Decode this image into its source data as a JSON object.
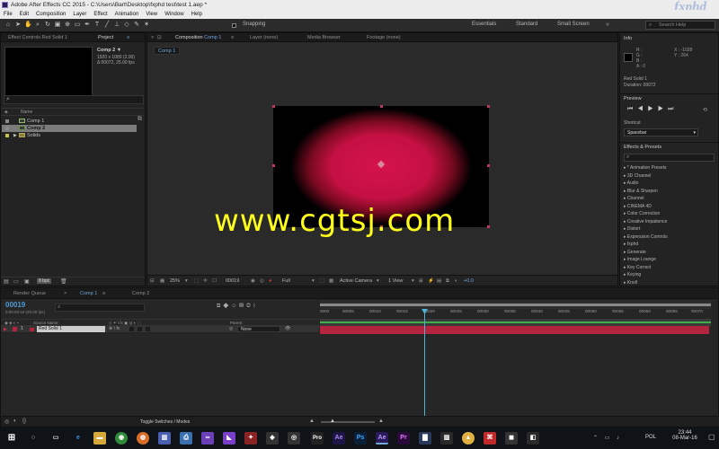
{
  "window": {
    "title": "Adobe After Effects CC 2015 - C:\\Users\\Bart\\Desktop\\fxphd test\\test 1.aep *"
  },
  "watermark_logo": "fxphd",
  "menu": [
    "File",
    "Edit",
    "Composition",
    "Layer",
    "Effect",
    "Animation",
    "View",
    "Window",
    "Help"
  ],
  "toolbar": {
    "snapping": "Snapping",
    "workspaces": [
      "Essentials",
      "Standard",
      "Small Screen"
    ],
    "search_placeholder": "Search Help"
  },
  "left_panel": {
    "tabs": [
      "Effect Controls Red Solid 1",
      "Project"
    ],
    "comp_name": "Comp 2 ▼",
    "comp_info": [
      "1920 x 1080 (2.00)",
      "Δ 00072, 25.00 fps"
    ],
    "column_name": "Name",
    "items": [
      {
        "name": "Comp 1",
        "color": "#8a8a8a"
      },
      {
        "name": "Comp 2",
        "color": "#8a8a8a"
      },
      {
        "name": "Solids",
        "color": "#c9c14a"
      }
    ],
    "bpc": "8 bpc"
  },
  "comp_panel": {
    "tabs": [
      {
        "label": "Composition",
        "accent": "Comp 1"
      },
      {
        "label": "Layer (none)"
      },
      {
        "label": "Media Browser"
      },
      {
        "label": "Footage (none)"
      }
    ],
    "breadcrumb": "Comp 1",
    "footer": {
      "zoom": "25%",
      "timecode": "00019",
      "resolution": "Full",
      "camera": "Active Camera",
      "views": "1 View",
      "exposure": "+0.0"
    }
  },
  "watermark_text": "www.cgtsj.com",
  "right_panel": {
    "info": {
      "title": "Info",
      "channels": [
        "R :",
        "G :",
        "B :",
        "A : 0"
      ],
      "coords": [
        "X : -1028",
        "Y : 264"
      ],
      "layer": "Red Solid 1",
      "duration": "Duration: 00072"
    },
    "preview": {
      "title": "Preview",
      "shortcut_label": "Shortcut",
      "shortcut_value": "Spacebar"
    },
    "effects": {
      "title": "Effects & Presets",
      "items": [
        "▸ * Animation Presets",
        "▸ 3D Channel",
        "▸ Audio",
        "▸ Blur & Sharpen",
        "▸ Channel",
        "▸ CINEMA 4D",
        "▸ Color Correction",
        "▸ Creative Impatience",
        "▸ Distort",
        "▸ Expression Controls",
        "▸ fxphd",
        "▸ Generate",
        "▸ Image Lounge",
        "▸ Key Correct",
        "▸ Keying",
        "▸ Knoll"
      ]
    }
  },
  "timeline": {
    "tabs": [
      "Render Queue",
      "Comp 1",
      "Comp 2"
    ],
    "timecode": "00019",
    "timecode_sub": "0:00:00:19 (25.00 fps)",
    "col_source": "Source Name",
    "col_parent": "Parent",
    "layer": {
      "num": "1",
      "name": "Red Solid 1",
      "parent": "None",
      "color": "#b4243f"
    },
    "ruler": [
      "0000",
      "00005",
      "00010",
      "00015",
      "00020",
      "00025",
      "00030",
      "00035",
      "00040",
      "00045",
      "00050",
      "00055",
      "00060",
      "00065",
      "00070"
    ],
    "toggle_label": "Toggle Switches / Modes"
  },
  "taskbar": {
    "time": "23:44",
    "date": "08-Mar-16",
    "lang": "POL"
  }
}
